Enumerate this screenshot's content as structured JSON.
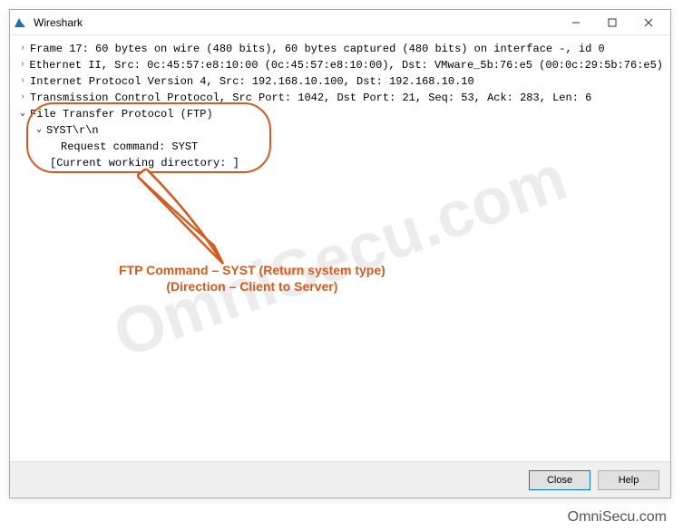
{
  "window": {
    "title": "Wireshark"
  },
  "tree": {
    "frame": "Frame 17: 60 bytes on wire (480 bits), 60 bytes captured (480 bits) on interface -, id 0",
    "ethernet": "Ethernet II, Src: 0c:45:57:e8:10:00 (0c:45:57:e8:10:00), Dst: VMware_5b:76:e5 (00:0c:29:5b:76:e5)",
    "ip": "Internet Protocol Version 4, Src: 192.168.10.100, Dst: 192.168.10.10",
    "tcp": "Transmission Control Protocol, Src Port: 1042, Dst Port: 21, Seq: 53, Ack: 283, Len: 6",
    "ftp": "File Transfer Protocol (FTP)",
    "syst": "SYST\\r\\n",
    "request": "Request command: SYST",
    "cwd": "[Current working directory: ]"
  },
  "callout": {
    "line1": "FTP Command – SYST (Return system type)",
    "line2": "(Direction –  Client to Server)"
  },
  "buttons": {
    "close": "Close",
    "help": "Help"
  },
  "watermark": "OmniSecu.com",
  "footer_brand": "OmniSecu.com"
}
